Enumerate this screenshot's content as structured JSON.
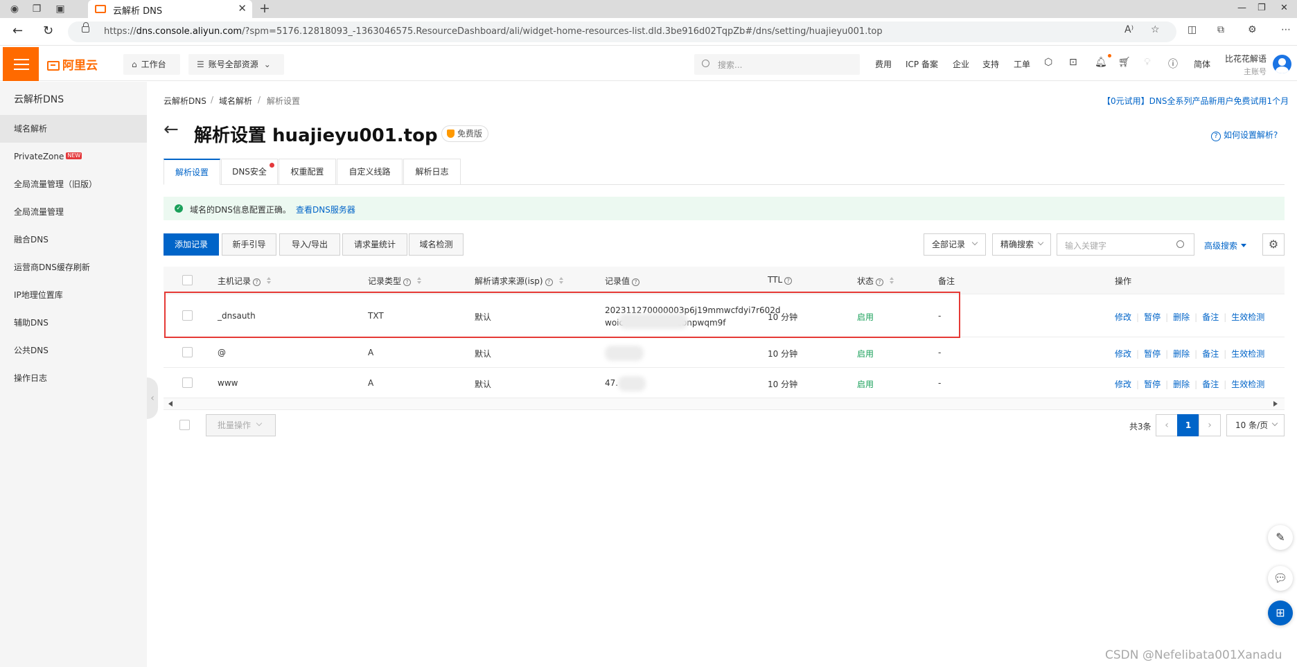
{
  "browser": {
    "tab_title": "云解析 DNS",
    "url_prefix": "https://",
    "url_host": "dns.console.aliyun.com",
    "url_rest": "/?spm=5176.12818093_-1363046575.ResourceDashboard/ali/widget-home-resources-list.dld.3be916d02TqpZb#/dns/setting/huajieyu001.top"
  },
  "appbar": {
    "logo": "阿里云",
    "workbench": "工作台",
    "resources": "账号全部资源",
    "search_placeholder": "搜索...",
    "links": [
      "费用",
      "ICP 备案",
      "企业",
      "支持",
      "工单"
    ],
    "lang": "简体",
    "account_name": "比花花解语",
    "account_sub": "主账号"
  },
  "sidebar": {
    "title": "云解析DNS",
    "items": [
      {
        "label": "域名解析",
        "active": true
      },
      {
        "label": "PrivateZone",
        "badge": "NEW"
      },
      {
        "label": "全局流量管理（旧版）"
      },
      {
        "label": "全局流量管理"
      },
      {
        "label": "融合DNS"
      },
      {
        "label": "运营商DNS缓存刷新"
      },
      {
        "label": "IP地理位置库"
      },
      {
        "label": "辅助DNS"
      },
      {
        "label": "公共DNS"
      },
      {
        "label": "操作日志"
      }
    ]
  },
  "breadcrumb": [
    "云解析DNS",
    "域名解析",
    "解析设置"
  ],
  "promo": "【0元试用】DNS全系列产品新用户免费试用1个月",
  "page": {
    "title": "解析设置 huajieyu001.top",
    "edition": "免费版",
    "help": "如何设置解析?"
  },
  "tabs": [
    "解析设置",
    "DNS安全",
    "权重配置",
    "自定义线路",
    "解析日志"
  ],
  "alert": {
    "text": "域名的DNS信息配置正确。",
    "link": "查看DNS服务器"
  },
  "toolbar": {
    "buttons": [
      "添加记录",
      "新手引导",
      "导入/导出",
      "请求量统计",
      "域名检测"
    ],
    "filter_all": "全部记录",
    "filter_exact": "精确搜索",
    "keyword_placeholder": "输入关键字",
    "advanced": "高级搜索"
  },
  "table": {
    "headers": [
      "主机记录",
      "记录类型",
      "解析请求来源(isp)",
      "记录值",
      "TTL",
      "状态",
      "备注",
      "操作"
    ],
    "rows": [
      {
        "host": "_dnsauth",
        "type": "TXT",
        "isp": "默认",
        "value_line1": "202311270000003p6j19mmwcfdyi7r602d",
        "value_line2": "woic",
        "value_tail": "cbnpwqm9f",
        "ttl": "10 分钟",
        "status": "启用",
        "note": "-"
      },
      {
        "host": "@",
        "type": "A",
        "isp": "默认",
        "value_line1": "",
        "value_line2": "",
        "value_tail": "",
        "ttl": "10 分钟",
        "status": "启用",
        "note": "-"
      },
      {
        "host": "www",
        "type": "A",
        "isp": "默认",
        "value_line1": "47.",
        "value_line2": "",
        "value_tail": "",
        "ttl": "10 分钟",
        "status": "启用",
        "note": "-"
      }
    ],
    "ops": [
      "修改",
      "暂停",
      "删除",
      "备注",
      "生效检测"
    ]
  },
  "footer": {
    "batch": "批量操作",
    "total": "共3条",
    "page": "1",
    "page_size": "10 条/页"
  },
  "watermark": "CSDN @Nefelibata001Xanadu",
  "colors": {
    "brand": "#ff6a00",
    "primary": "#0064c8",
    "success": "#1aa05a",
    "highlight": "#e53935"
  }
}
